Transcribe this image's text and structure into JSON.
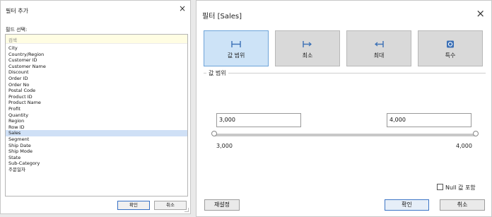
{
  "left_dialog": {
    "title": "필터 추가",
    "close_symbol": "×",
    "field_select_label": "필드 선택:",
    "search_placeholder": "검색",
    "fields": [
      "City",
      "Country/Region",
      "Customer ID",
      "Customer Name",
      "Discount",
      "Order ID",
      "Order No",
      "Postal Code",
      "Product ID",
      "Product Name",
      "Profit",
      "Quantity",
      "Region",
      "Row ID",
      "Sales",
      "Segment",
      "Ship Date",
      "Ship Mode",
      "State",
      "Sub-Category",
      "주문일자"
    ],
    "selected_field": "Sales",
    "ok_label": "확인",
    "cancel_label": "취소"
  },
  "right_dialog": {
    "title": "필터 [Sales]",
    "close_symbol": "×",
    "type_buttons": [
      {
        "label": "값 범위",
        "icon": "range-icon",
        "active": true
      },
      {
        "label": "최소",
        "icon": "at-least-icon",
        "active": false
      },
      {
        "label": "최대",
        "icon": "at-most-icon",
        "active": false
      },
      {
        "label": "특수",
        "icon": "special-icon",
        "active": false
      }
    ],
    "range_group_label": "값 범위",
    "min_input": "3,000",
    "max_input": "4,000",
    "range_min_label": "3,000",
    "range_max_label": "4,000",
    "include_null_label": "Null 값 포함",
    "reset_label": "재설정",
    "ok_label": "확인",
    "cancel_label": "취소"
  },
  "colors": {
    "active_button": "#cde3f7",
    "selection": "#cfe0f6",
    "search_bg": "#fffde3"
  }
}
